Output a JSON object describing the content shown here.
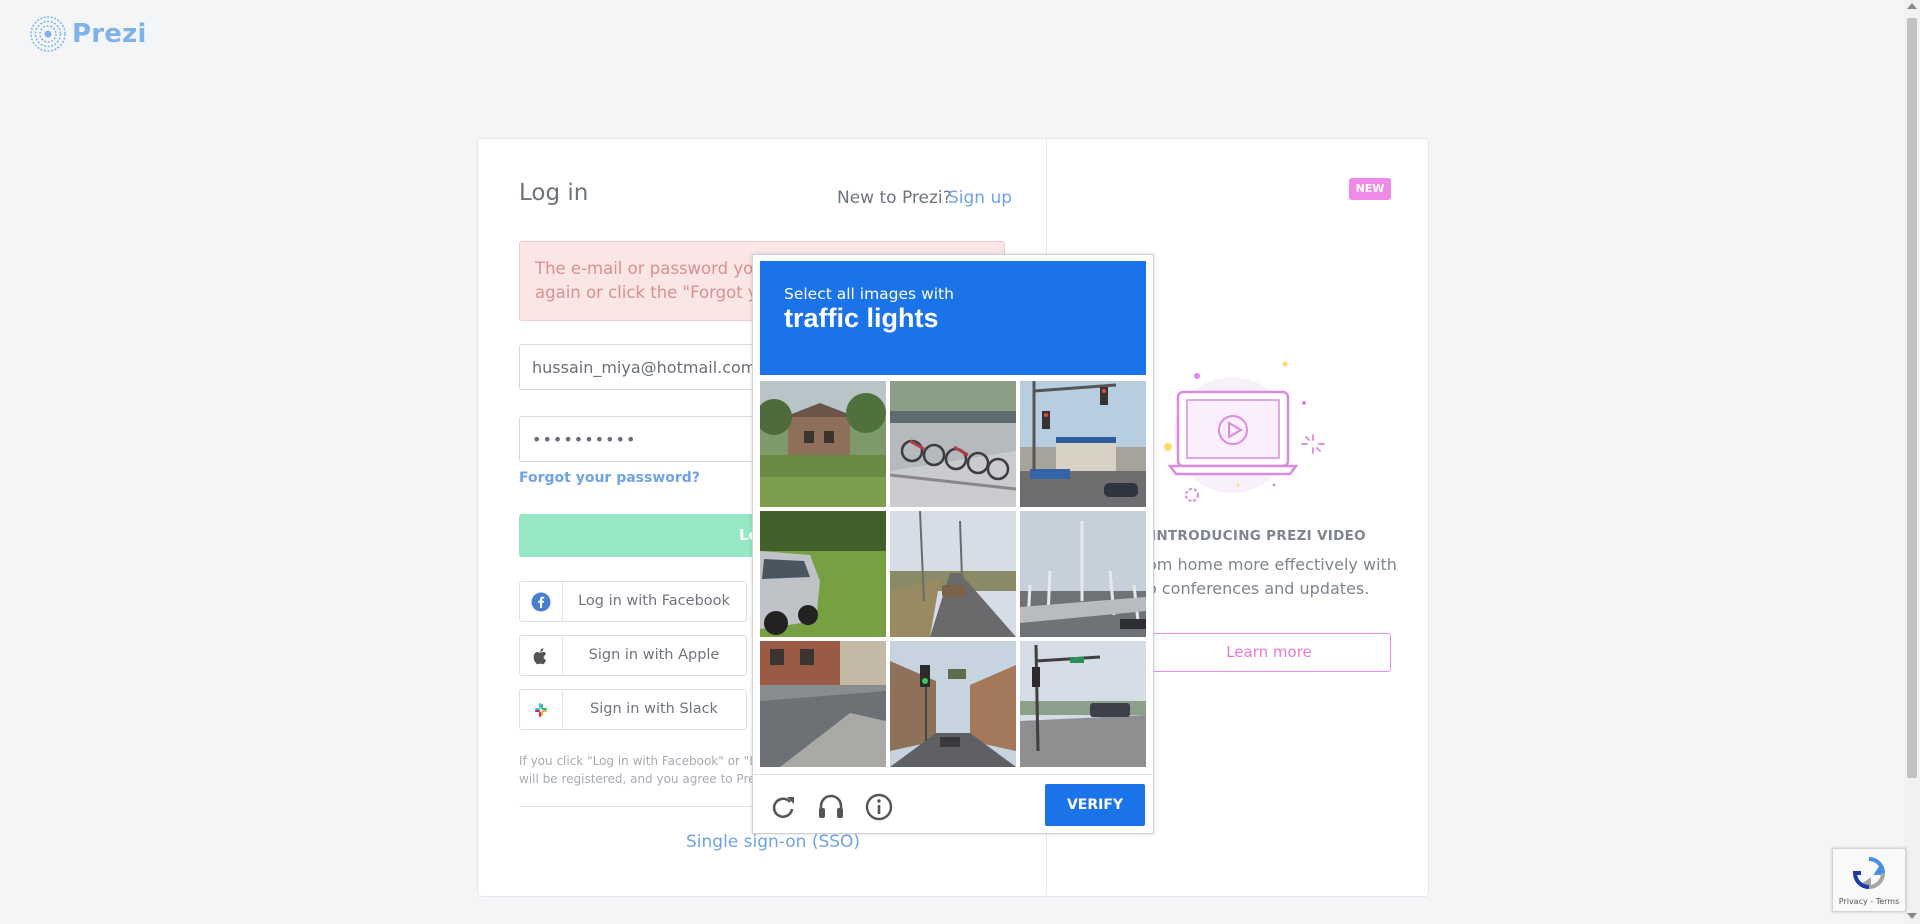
{
  "brand": {
    "name": "Prezi"
  },
  "login": {
    "title": "Log in",
    "new_to_prezi": "New to Prezi?",
    "sign_up": "Sign up",
    "error_line1": "The e-mail or password you e",
    "error_line2": "again or click the \"Forgot you",
    "email_value": "hussain_miya@hotmail.com",
    "password_value": "••••••••••",
    "forgot": "Forgot your password?",
    "login_button": "Lo",
    "social": [
      {
        "label": "Log in with Facebook",
        "icon": "facebook-icon"
      },
      {
        "label": "Sign in with Apple",
        "icon": "apple-icon"
      },
      {
        "label": "Sign in with Slack",
        "icon": "slack-icon"
      }
    ],
    "fine_line1": "If you click \"Log in with Facebook\" or \"Log",
    "fine_line2": "will be registered, and you agree to Prezi's",
    "sso": "Single sign-on (SSO)"
  },
  "promo": {
    "badge": "NEW",
    "title": "INTRODUCING PREZI VIDEO",
    "desc_line1": "om home more effectively with",
    "desc_line2": "o conferences and updates.",
    "learn_more": "Learn more"
  },
  "captcha": {
    "prompt": "Select all images with",
    "target": "traffic lights",
    "verify": "VERIFY",
    "tiles": [
      "building-with-trees",
      "bicycles-on-rack",
      "intersection-with-traffic-light",
      "car-on-grass",
      "road-with-poles",
      "bridge-with-lampposts",
      "street-corner-sidewalk",
      "city-street-with-traffic-light",
      "intersection-with-signal-pole"
    ],
    "icons": [
      "reload-icon",
      "audio-icon",
      "info-icon"
    ]
  },
  "recaptcha_badge": {
    "text": "Privacy - Terms"
  },
  "colors": {
    "brand": "#7fb2ea",
    "link": "#6ea3e8",
    "green": "#96e8c4",
    "captcha_blue": "#1a73e8",
    "pink": "#f08ae8"
  }
}
